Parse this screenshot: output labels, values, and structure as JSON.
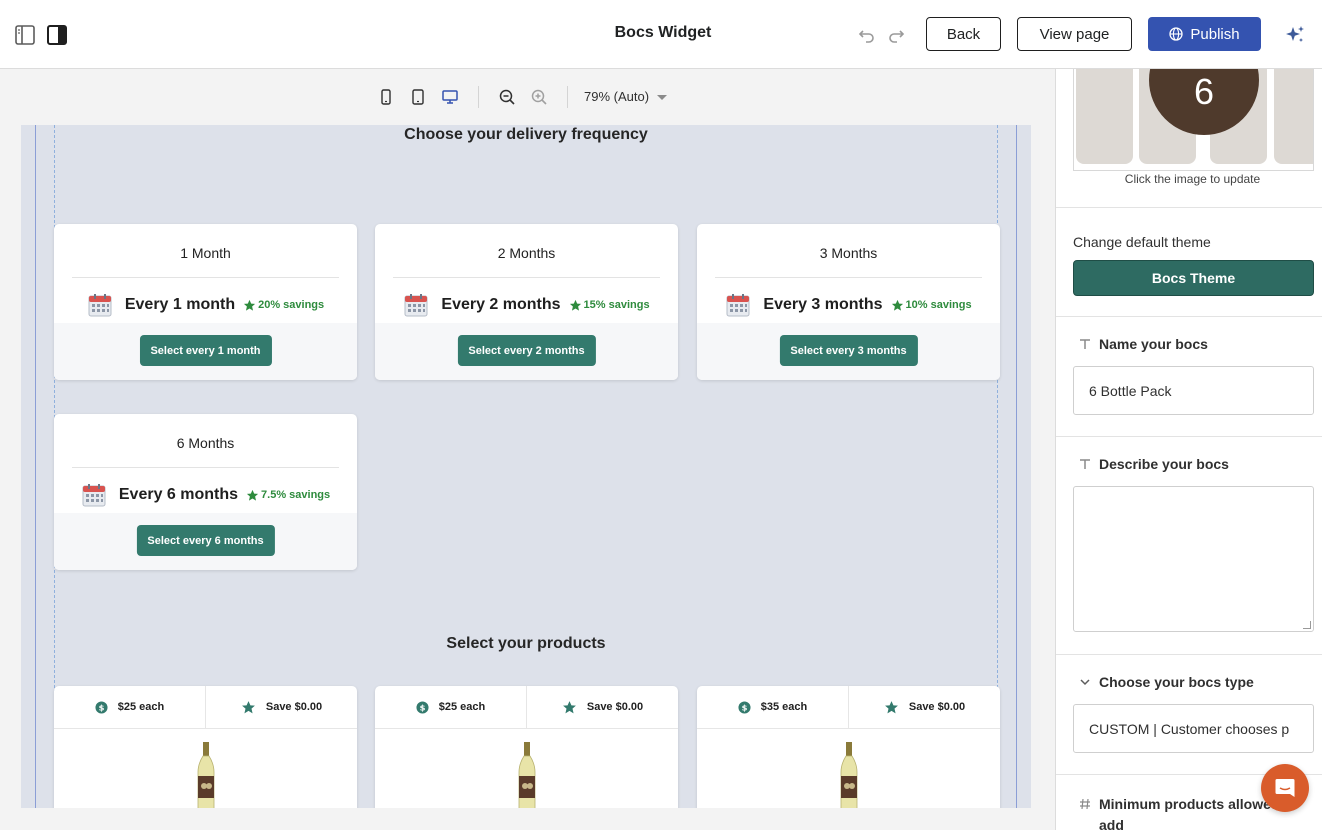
{
  "header": {
    "title": "Bocs Widget",
    "back_label": "Back",
    "view_page_label": "View page",
    "publish_label": "Publish"
  },
  "canvas_toolbar": {
    "zoom_label": "79% (Auto)",
    "active_device": "desktop"
  },
  "widget": {
    "frequency_title": "Choose your delivery frequency",
    "frequencies": [
      {
        "title": "1 Month",
        "label": "Every 1 month",
        "savings": "20% savings",
        "button": "Select every 1 month"
      },
      {
        "title": "2 Months",
        "label": "Every 2 months",
        "savings": "15% savings",
        "button": "Select every 2 months"
      },
      {
        "title": "3 Months",
        "label": "Every 3 months",
        "savings": "10% savings",
        "button": "Select every 3 months"
      },
      {
        "title": "6 Months",
        "label": "Every 6 months",
        "savings": "7.5% savings",
        "button": "Select every 6 months"
      }
    ],
    "products_title": "Select your products",
    "products": [
      {
        "price": "$25 each",
        "save": "Save $0.00"
      },
      {
        "price": "$25 each",
        "save": "Save $0.00"
      },
      {
        "price": "$35 each",
        "save": "Save $0.00"
      }
    ]
  },
  "panel": {
    "image_badge": "6",
    "image_caption": "Click the image to update",
    "theme_label": "Change default theme",
    "theme_button": "Bocs Theme",
    "name_label": "Name your bocs",
    "name_value": "6 Bottle Pack",
    "describe_label": "Describe your bocs",
    "describe_value": "",
    "type_label": "Choose your bocs type",
    "type_value": "CUSTOM | Customer chooses p",
    "min_label_line1": "Minimum products allowed to",
    "min_label_line2": "add"
  },
  "colors": {
    "accent_green": "#337a6d",
    "theme_green": "#2e6b62",
    "publish_blue": "#3453b0",
    "savings_green": "#2e8b3d",
    "chat_orange": "#d95c2b"
  }
}
